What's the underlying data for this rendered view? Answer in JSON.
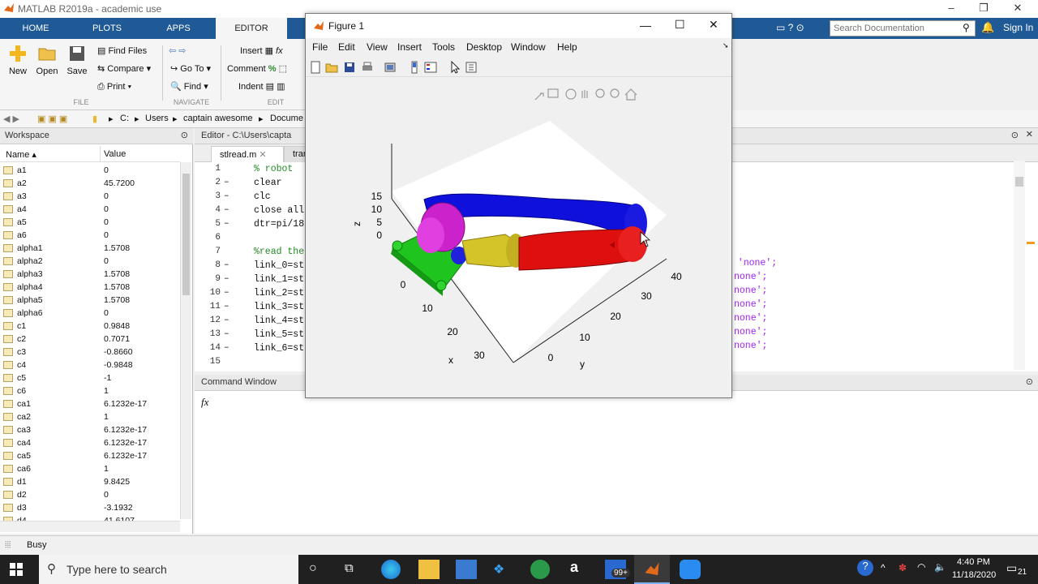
{
  "window": {
    "title": "MATLAB R2019a - academic use"
  },
  "ribbon": {
    "tabs": [
      "HOME",
      "PLOTS",
      "APPS",
      "EDITOR"
    ],
    "file": {
      "new": "New",
      "open": "Open",
      "save": "Save",
      "find_files": "Find Files",
      "compare": "Compare",
      "print": "Print",
      "section": "FILE"
    },
    "navigate": {
      "go_to": "Go To",
      "find": "Find",
      "section": "NAVIGATE"
    },
    "edit": {
      "insert": "Insert",
      "comment": "Comment",
      "indent": "Indent",
      "section": "EDIT"
    }
  },
  "search": {
    "placeholder": "Search Documentation"
  },
  "signin": "Sign In",
  "address": {
    "path": [
      "C:",
      "Users",
      "captain awesome",
      "Docume"
    ]
  },
  "workspace": {
    "title": "Workspace",
    "col_name": "Name",
    "col_value": "Value",
    "rows": [
      {
        "name": "a1",
        "value": "0"
      },
      {
        "name": "a2",
        "value": "45.7200"
      },
      {
        "name": "a3",
        "value": "0"
      },
      {
        "name": "a4",
        "value": "0"
      },
      {
        "name": "a5",
        "value": "0"
      },
      {
        "name": "a6",
        "value": "0"
      },
      {
        "name": "alpha1",
        "value": "1.5708"
      },
      {
        "name": "alpha2",
        "value": "0"
      },
      {
        "name": "alpha3",
        "value": "1.5708"
      },
      {
        "name": "alpha4",
        "value": "1.5708"
      },
      {
        "name": "alpha5",
        "value": "1.5708"
      },
      {
        "name": "alpha6",
        "value": "0"
      },
      {
        "name": "c1",
        "value": "0.9848"
      },
      {
        "name": "c2",
        "value": "0.7071"
      },
      {
        "name": "c3",
        "value": "-0.8660"
      },
      {
        "name": "c4",
        "value": "-0.9848"
      },
      {
        "name": "c5",
        "value": "-1"
      },
      {
        "name": "c6",
        "value": "1"
      },
      {
        "name": "ca1",
        "value": "6.1232e-17"
      },
      {
        "name": "ca2",
        "value": "1"
      },
      {
        "name": "ca3",
        "value": "6.1232e-17"
      },
      {
        "name": "ca4",
        "value": "6.1232e-17"
      },
      {
        "name": "ca5",
        "value": "6.1232e-17"
      },
      {
        "name": "ca6",
        "value": "1"
      },
      {
        "name": "d1",
        "value": "9.8425"
      },
      {
        "name": "d2",
        "value": "0"
      },
      {
        "name": "d3",
        "value": "-3.1932"
      },
      {
        "name": "d4",
        "value": "41.6107"
      }
    ]
  },
  "editor": {
    "title": "Editor - C:\\Users\\capta",
    "tabs": [
      "stlread.m",
      "tran"
    ],
    "lines": [
      {
        "n": "1",
        "dash": "",
        "code": "% robot",
        "type": "cm"
      },
      {
        "n": "2",
        "dash": "–",
        "code": "clear",
        "type": ""
      },
      {
        "n": "3",
        "dash": "–",
        "code": "clc",
        "type": ""
      },
      {
        "n": "4",
        "dash": "–",
        "code": "close all",
        "type": ""
      },
      {
        "n": "5",
        "dash": "–",
        "code": "dtr=pi/18",
        "type": ""
      },
      {
        "n": "6",
        "dash": "",
        "code": "",
        "type": ""
      },
      {
        "n": "7",
        "dash": "",
        "code": "%read the",
        "type": "cm"
      },
      {
        "n": "8",
        "dash": "–",
        "code": "link_0=st",
        "type": ""
      },
      {
        "n": "9",
        "dash": "–",
        "code": "link_1=st",
        "type": ""
      },
      {
        "n": "10",
        "dash": "–",
        "code": "link_2=st",
        "type": ""
      },
      {
        "n": "11",
        "dash": "–",
        "code": "link_3=st",
        "type": ""
      },
      {
        "n": "12",
        "dash": "–",
        "code": "link_4=st",
        "type": ""
      },
      {
        "n": "13",
        "dash": "–",
        "code": "link_5=st",
        "type": ""
      },
      {
        "n": "14",
        "dash": "–",
        "code": "link_6=st",
        "type": ""
      },
      {
        "n": "15",
        "dash": "",
        "code": "",
        "type": ""
      }
    ],
    "right_fragments": [
      "= 'none';",
      "none';",
      "none';",
      "none';",
      "none';",
      "none';",
      "none';"
    ]
  },
  "command_window": {
    "title": "Command Window",
    "prompt": "fx"
  },
  "status": {
    "text": "Busy"
  },
  "figure": {
    "title": "Figure 1",
    "menu": [
      "File",
      "Edit",
      "View",
      "Insert",
      "Tools",
      "Desktop",
      "Window",
      "Help"
    ],
    "z_ticks": [
      "15",
      "10",
      "5",
      "0"
    ],
    "x_ticks": [
      "0",
      "10",
      "20",
      "30"
    ],
    "y_ticks": [
      "0",
      "10",
      "20",
      "30",
      "40"
    ],
    "z_label": "z",
    "x_label": "x",
    "y_label": "y",
    "colors": {
      "base": "#1fc41f",
      "link1": "#cc22cc",
      "link2": "#1010dd",
      "link3": "#d4c42a",
      "link4": "#dd0f0f"
    }
  },
  "taskbar": {
    "search": "Type here to search",
    "time": "4:40 PM",
    "date": "11/18/2020",
    "badge": "99+",
    "notif": "21"
  }
}
